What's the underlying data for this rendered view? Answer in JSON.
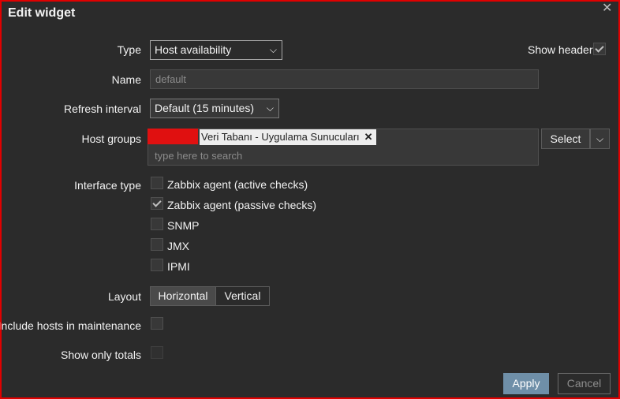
{
  "dialog": {
    "title": "Edit widget",
    "close_glyph": "✕"
  },
  "fields": {
    "type_label": "Type",
    "type_value": "Host availability",
    "show_header_label": "Show header",
    "show_header_checked": true,
    "name_label": "Name",
    "name_placeholder": "default",
    "refresh_label": "Refresh interval",
    "refresh_value": "Default (15 minutes)",
    "host_groups_label": "Host groups",
    "host_group_chip": "Veri Tabanı - Uygulama Sunucuları",
    "host_groups_placeholder": "type here to search",
    "select_button": "Select",
    "interface_type_label": "Interface type",
    "interface_options": [
      {
        "label": "Zabbix agent (active checks)",
        "checked": false
      },
      {
        "label": "Zabbix agent (passive checks)",
        "checked": true
      },
      {
        "label": "SNMP",
        "checked": false
      },
      {
        "label": "JMX",
        "checked": false
      },
      {
        "label": "IPMI",
        "checked": false
      }
    ],
    "layout_label": "Layout",
    "layout_options": [
      "Horizontal",
      "Vertical"
    ],
    "layout_selected": "Horizontal",
    "maintenance_label": "Include hosts in maintenance",
    "maintenance_checked": false,
    "totals_label": "Show only totals",
    "totals_checked": false
  },
  "footer": {
    "apply": "Apply",
    "cancel": "Cancel"
  },
  "icons": {
    "dropdown": "chevron-down-icon",
    "close": "close-icon",
    "chip_remove": "remove-icon"
  },
  "colors": {
    "background": "#2b2b2b",
    "apply_button": "#6f8fa8",
    "redaction": "#e01010",
    "frame_border": "#e00000"
  }
}
